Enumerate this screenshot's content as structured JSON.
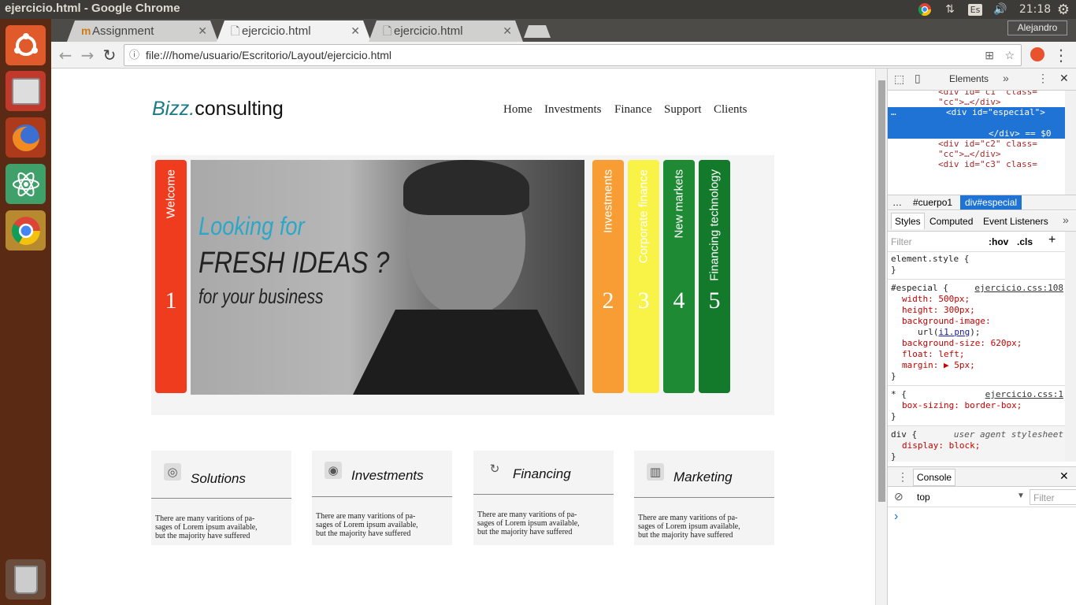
{
  "os": {
    "window_title": "ejercicio.html - Google Chrome",
    "keyboard_layout": "Es",
    "clock": "21:18",
    "user": "Alejandro"
  },
  "browser": {
    "tabs": [
      {
        "label": "Assignment",
        "active": false
      },
      {
        "label": "ejercicio.html",
        "active": true
      },
      {
        "label": "ejercicio.html",
        "active": false
      }
    ],
    "url": "file:///home/usuario/Escritorio/Layout/ejercicio.html"
  },
  "page": {
    "logo_accent": "Bizz.",
    "logo_main": "consulting",
    "nav": [
      "Home",
      "Investments",
      "Finance",
      "Support",
      "Clients"
    ],
    "strips": [
      {
        "label": "Welcome",
        "num": "1",
        "color": "#f03c1e"
      },
      {
        "label": "Investments",
        "num": "2",
        "color": "#f89c34"
      },
      {
        "label": "Corporate finance",
        "num": "3",
        "color": "#f8f346"
      },
      {
        "label": "New markets",
        "num": "4",
        "color": "#1e8a34"
      },
      {
        "label": "Financing technology",
        "num": "5",
        "color": "#137a2b"
      }
    ],
    "photo_text": {
      "line1": "Looking for",
      "line2": "FRESH IDEAS ?",
      "line3": "for your business"
    },
    "cards": [
      {
        "title": "Solutions",
        "icon": "target-arrow-icon",
        "text": [
          "There are many varitions of pa-",
          "sages of Lorem ipsum available,",
          "but the majority have suffered"
        ]
      },
      {
        "title": "Investments",
        "icon": "bullseye-icon",
        "text": [
          "There are many varitions of pa-",
          "sages of Lorem ipsum available,",
          "but the majority have suffered"
        ]
      },
      {
        "title": "Financing",
        "icon": "refresh-icon",
        "text": [
          "There are many varitions of pa-",
          "sages of Lorem ipsum available,",
          "but the majority have suffered"
        ]
      },
      {
        "title": "Marketing",
        "icon": "bar-chart-icon",
        "text": [
          "There are many varitions of pa-",
          "sages of Lorem ipsum available,",
          "but the majority have suffered"
        ]
      }
    ]
  },
  "devtools": {
    "tab_elements": "Elements",
    "dom_lines": {
      "l1": "<div id=\"c1\" class=",
      "l2": "\"cc\">…</div>",
      "l3": "<div id=\"especial\">",
      "l4": "</div> == $0",
      "l5": "<div id=\"c2\" class=",
      "l6": "\"cc\">…</div>",
      "l7": "<div id=\"c3\" class="
    },
    "breadcrumb": [
      "…",
      "#cuerpo1",
      "div#especial"
    ],
    "styles_tabs": [
      "Styles",
      "Computed",
      "Event Listeners"
    ],
    "filter_placeholder": "Filter",
    "hov": ":hov",
    "cls": ".cls",
    "rules": {
      "element_style": "element.style {",
      "close": "}",
      "especial_selector": "#especial {",
      "especial_source": "ejercicio.css:108",
      "p1": "width: 500px;",
      "p2": "height: 300px;",
      "p3": "background-image:",
      "p4a": "url(",
      "p4link": "i1.png",
      "p4b": ");",
      "p5": "background-size: 620px;",
      "p6": "float: left;",
      "p7": "margin: ▶ 5px;",
      "star_selector": "* {",
      "star_source": "ejercicio.css:1",
      "p8": "box-sizing: border-box;",
      "div_selector": "div {",
      "div_source": "user agent stylesheet",
      "p9": "display: block;"
    },
    "console_tab": "Console",
    "console_context": "top",
    "console_filter": "Filter",
    "console_prompt": "›"
  }
}
